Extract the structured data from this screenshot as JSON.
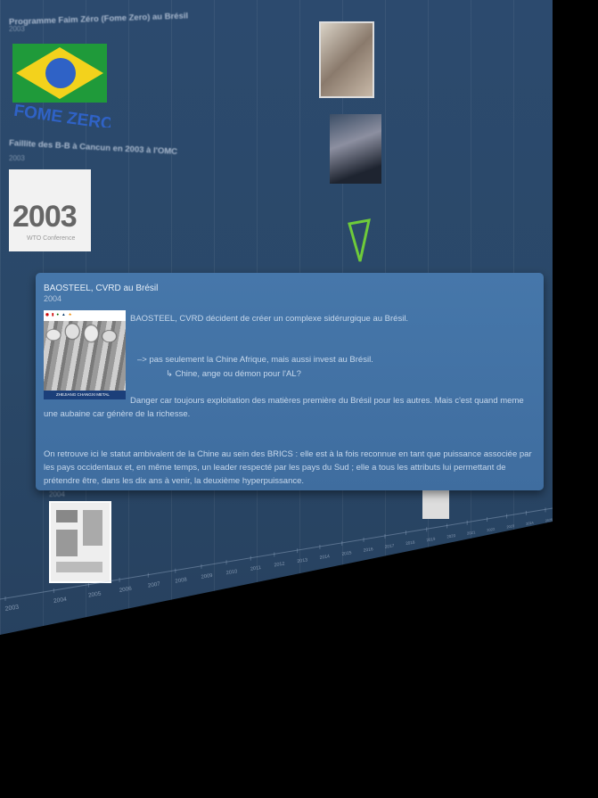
{
  "background": {
    "programme_title": "Programme Faim Zéro (Fome Zero) au Brésil",
    "programme_year": "2003",
    "faillite_title": "Faillite des B-B à Cancun en 2003 à l'OMC",
    "faillite_year": "2003",
    "thumb_2003_year": "2003",
    "thumb_2003_sub": "WTO Conference",
    "fome_zero_logo_text": "FOME ZERO",
    "bottom_year": "2004"
  },
  "popup": {
    "title": "BAOSTEEL, CVRD au Brésil",
    "year": "2004",
    "image_footer": "ZHEJIANG CHANGXI METAL PRODUCTS CO., LTD",
    "line1": "BAOSTEEL, CVRD décident de créer un complexe sidérurgique au Brésil.",
    "line2": "–> pas seulement la Chine Afrique, mais aussi invest au Brésil.",
    "line3": "↳ Chine, ange ou démon pour l'AL?",
    "line4": "Danger car toujours exploitation des matières première du Brésil pour les autres. Mais c'est quand meme une aubaine car génère de la richesse.",
    "line5": "On retrouve ici le statut ambivalent de la Chine au sein des BRICS : elle est à la fois reconnue en tant que puissance associée par les pays occidentaux et, en même temps, un leader respecté par les pays du Sud ; elle a tous les attributs lui permettant de prétendre être, dans les dix ans à venir, la deuxième hyperpuissance."
  },
  "timeline": {
    "years": [
      "2003",
      "2004",
      "2005",
      "2006",
      "2007",
      "2008",
      "2009",
      "2010",
      "2011",
      "2012",
      "2013",
      "2014",
      "2015",
      "2016",
      "2017",
      "2018",
      "2019",
      "2020",
      "2021",
      "2022",
      "2023",
      "2024",
      "2025"
    ]
  },
  "colors": {
    "surface": "#2c4a6e",
    "popup": "#4677aa",
    "text": "#c7d8ec"
  }
}
